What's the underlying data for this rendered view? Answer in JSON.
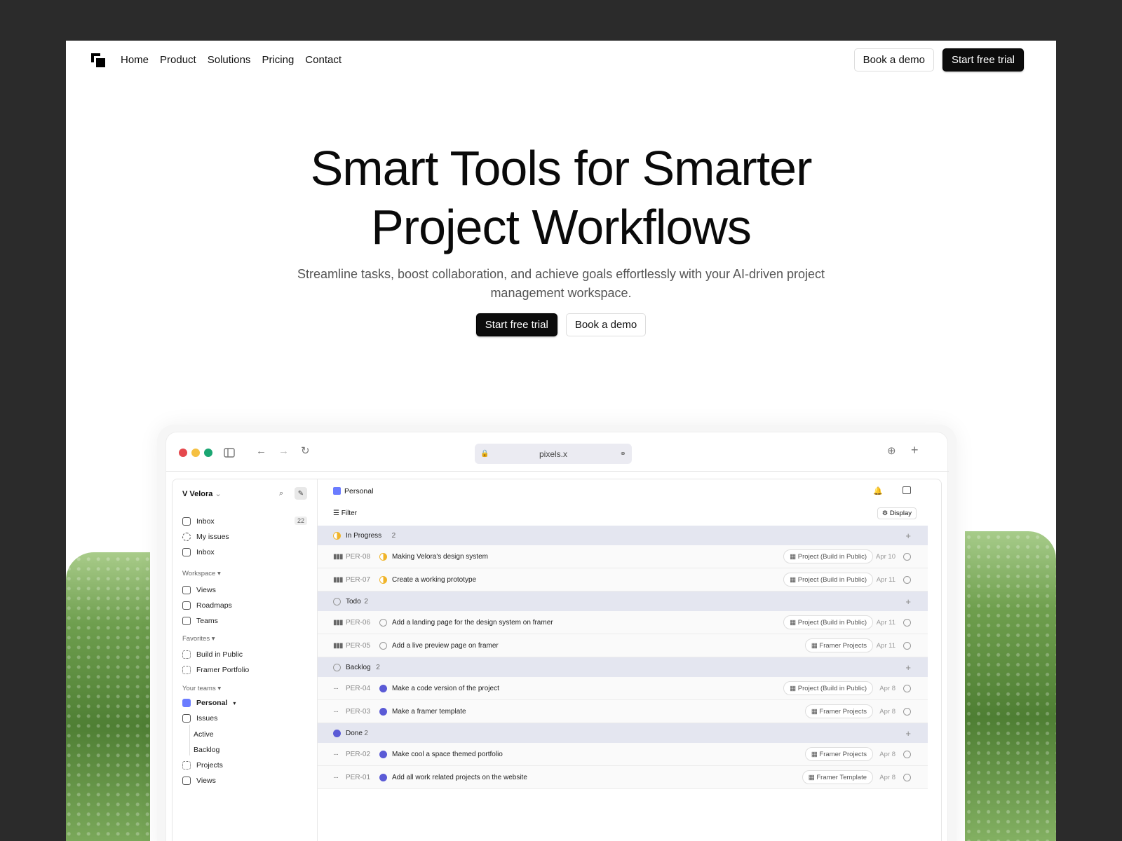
{
  "nav": {
    "links": [
      "Home",
      "Product",
      "Solutions",
      "Pricing",
      "Contact"
    ],
    "book_demo": "Book a demo",
    "start_trial": "Start free trial"
  },
  "hero": {
    "title_line1": "Smart Tools for Smarter",
    "title_line2": "Project Workflows",
    "subtitle": "Streamline tasks, boost collaboration, and achieve goals effortlessly with your AI-driven project management workspace.",
    "cta_primary": "Start free trial",
    "cta_secondary": "Book a demo"
  },
  "browser": {
    "url": "pixels.x",
    "dot_colors": [
      "#e5484d",
      "#f5c042",
      "#1aa672"
    ]
  },
  "sidebar": {
    "workspace_name": "Velora",
    "inbox_count": "22",
    "top_items": [
      "Inbox",
      "My issues",
      "Inbox"
    ],
    "workspace_label": "Workspace",
    "workspace_items": [
      "Views",
      "Roadmaps",
      "Teams"
    ],
    "favorites_label": "Favorites",
    "favorites_items": [
      "Build in Public",
      "Framer Portfolio"
    ],
    "teams_label": "Your teams",
    "team_name": "Personal",
    "team_items": [
      "Issues",
      "Active",
      "Backlog",
      "Projects",
      "Views"
    ]
  },
  "main": {
    "header_title": "Personal",
    "filter_label": "Filter",
    "display_label": "Display",
    "groups": [
      {
        "name": "In Progress",
        "count": "2",
        "rows": [
          {
            "id": "PER-08",
            "title": "Making Velora's design system",
            "tag": "Project (Build in Public)",
            "date": "Apr 10"
          },
          {
            "id": "PER-07",
            "title": "Create a working prototype",
            "tag": "Project (Build in Public)",
            "date": "Apr 11"
          }
        ]
      },
      {
        "name": "Todo",
        "count": "2",
        "rows": [
          {
            "id": "PER-06",
            "title": "Add a landing page for the design system on framer",
            "tag": "Project (Build in Public)",
            "date": "Apr 11"
          },
          {
            "id": "PER-05",
            "title": "Add a live preview page on framer",
            "tag": "Framer Projects",
            "date": "Apr 11"
          }
        ]
      },
      {
        "name": "Backlog",
        "count": "2",
        "rows": [
          {
            "id": "PER-04",
            "title": "Make a code version of the project",
            "tag": "Project (Build in Public)",
            "date": "Apr 8"
          },
          {
            "id": "PER-03",
            "title": "Make a framer template",
            "tag": "Framer Projects",
            "date": "Apr 8"
          }
        ]
      },
      {
        "name": "Done",
        "count": "2",
        "rows": [
          {
            "id": "PER-02",
            "title": "Make cool a space themed portfolio",
            "tag": "Framer Projects",
            "date": "Apr 8"
          },
          {
            "id": "PER-01",
            "title": "Add all work related projects on the website",
            "tag": "Framer Template",
            "date": "Apr 8"
          }
        ]
      }
    ]
  }
}
